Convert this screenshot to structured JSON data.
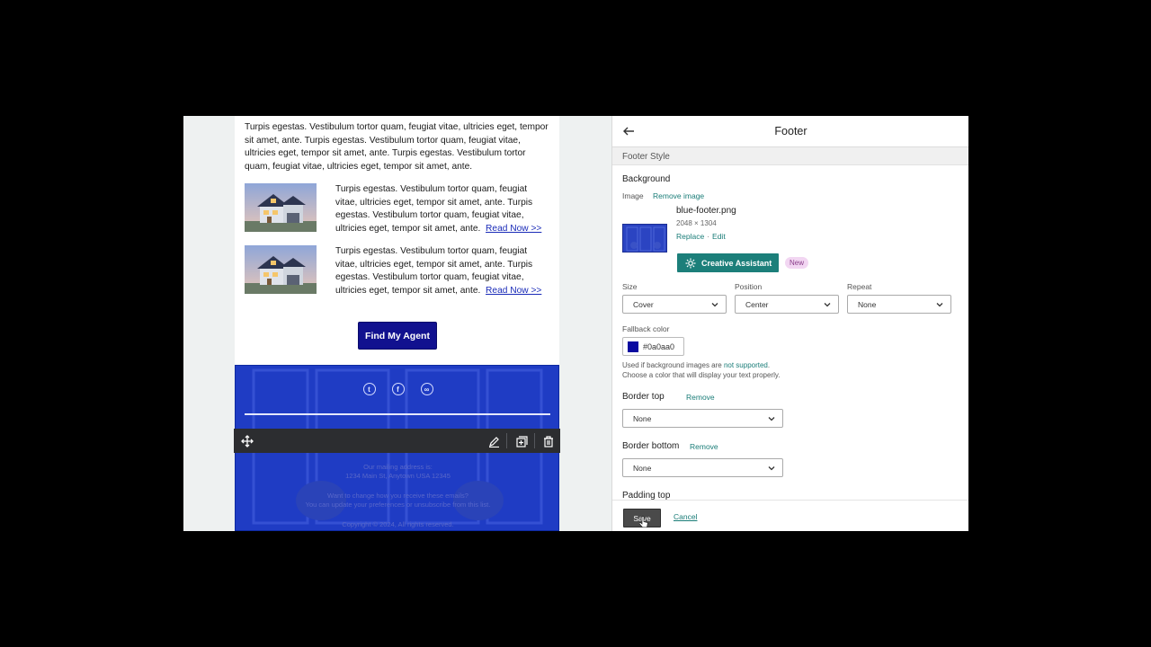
{
  "email": {
    "intro_text": "Turpis egestas. Vestibulum tortor quam, feugiat vitae, ultricies eget, tempor sit amet, ante. Turpis egestas. Vestibulum tortor quam, feugiat vitae, ultricies eget, tempor sit amet, ante. Turpis egestas. Vestibulum tortor quam, feugiat vitae, ultricies eget, tempor sit amet, ante.",
    "articles": [
      {
        "text": "Turpis egestas. Vestibulum tortor quam, feugiat vitae, ultricies eget, tempor sit amet, ante. Turpis egestas. Vestibulum tortor quam, feugiat vitae, ultricies eget, tempor sit amet, ante.",
        "link": "Read Now >>"
      },
      {
        "text": "Turpis egestas. Vestibulum tortor quam, feugiat vitae, ultricies eget, tempor sit amet, ante. Turpis egestas. Vestibulum tortor quam, feugiat vitae, ultricies eget, tempor sit amet, ante.",
        "link": "Read Now >>"
      }
    ],
    "cta_label": "Find My Agent",
    "footer": {
      "social_icons": [
        "twitter-icon",
        "facebook-icon",
        "link-icon"
      ],
      "address_line1": "Our mailing address is:",
      "address_line2": "1234 Main St, Anytown USA 12345",
      "prefs_line1": "Want to change how you receive these emails?",
      "prefs_line2": "You can update your preferences or unsubscribe from this list.",
      "copyright": "Copyright © 2024, All rights reserved."
    }
  },
  "toolbar": {
    "icons": [
      "move-icon",
      "edit-icon",
      "duplicate-icon",
      "delete-icon"
    ]
  },
  "panel": {
    "title": "Footer",
    "section": "Footer Style",
    "background_label": "Background",
    "image_label": "Image",
    "remove_image": "Remove image",
    "file_name": "blue-footer.png",
    "file_dims": "2048 × 1304",
    "replace": "Replace",
    "separator": "·",
    "edit": "Edit",
    "creative_assistant": "Creative Assistant",
    "new_badge": "New",
    "size_label": "Size",
    "size_value": "Cover",
    "position_label": "Position",
    "position_value": "Center",
    "repeat_label": "Repeat",
    "repeat_value": "None",
    "fallback_label": "Fallback color",
    "fallback_value": "#0a0aa0",
    "help_prefix": "Used if background images are ",
    "help_link": "not supported",
    "help_suffix": ".",
    "help_line2": "Choose a color that will display your text properly.",
    "border_top_label": "Border top",
    "border_top_remove": "Remove",
    "border_top_value": "None",
    "border_bottom_label": "Border bottom",
    "border_bottom_remove": "Remove",
    "border_bottom_value": "None",
    "padding_top_label": "Padding top",
    "save": "Save",
    "cancel": "Cancel"
  },
  "colors": {
    "accent": "#1c7f7a",
    "cta": "#11118f",
    "footer_bg": "#1f3cc4",
    "fallback": "#0a0aa0"
  }
}
